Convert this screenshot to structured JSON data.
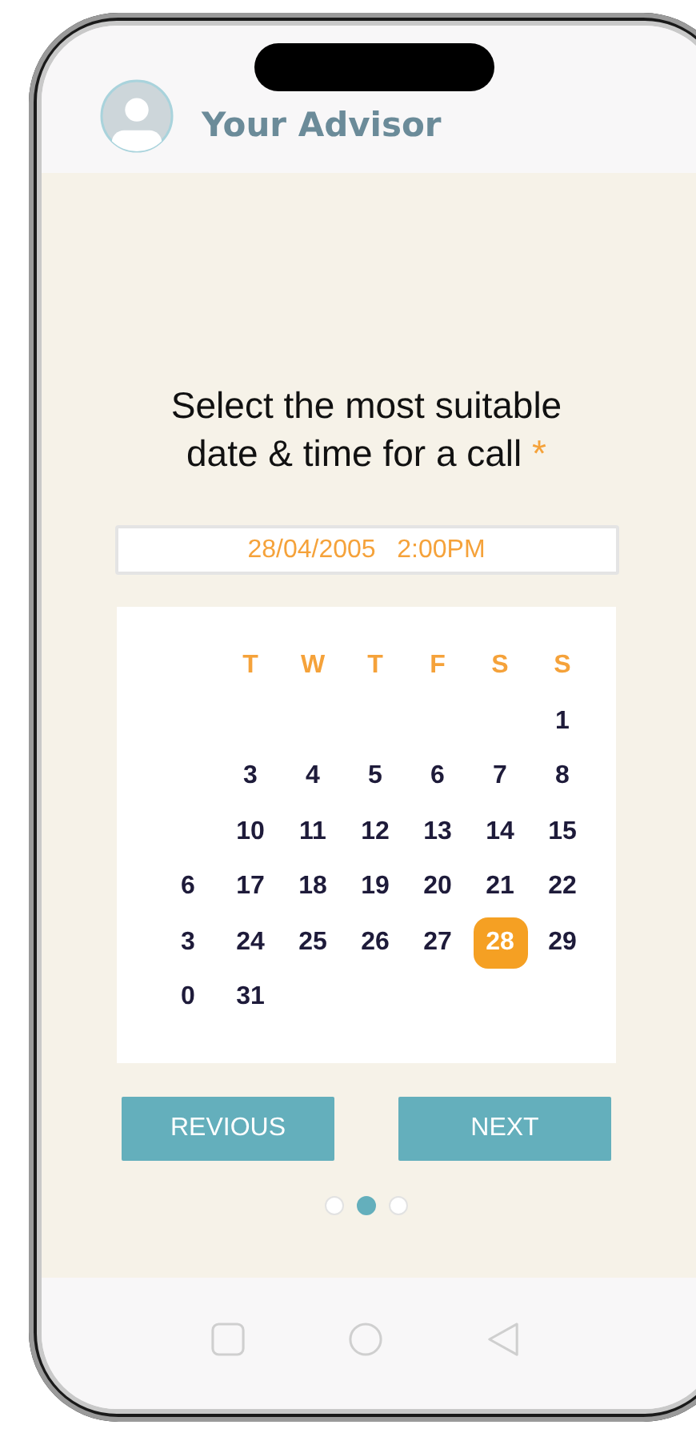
{
  "header": {
    "title": "Your Advisor"
  },
  "prompt": {
    "text": "Select the most suitable date & time for a call",
    "required_mark": "*"
  },
  "datetime_field": {
    "value": "28/04/2005   2:00PM"
  },
  "calendar": {
    "weekdays": [
      "T",
      "W",
      "T",
      "F",
      "S",
      "S"
    ],
    "weeks": [
      [
        {
          "day": "1",
          "selected": false
        }
      ],
      [
        {
          "day": "3",
          "selected": false
        },
        {
          "day": "4",
          "selected": false
        },
        {
          "day": "5",
          "selected": false
        },
        {
          "day": "6",
          "selected": false
        },
        {
          "day": "7",
          "selected": false
        },
        {
          "day": "8",
          "selected": false
        }
      ],
      [
        {
          "day": "10",
          "selected": false
        },
        {
          "day": "11",
          "selected": false
        },
        {
          "day": "12",
          "selected": false
        },
        {
          "day": "13",
          "selected": false
        },
        {
          "day": "14",
          "selected": false
        },
        {
          "day": "15",
          "selected": false
        }
      ],
      [
        {
          "day": "6",
          "selected": false
        },
        {
          "day": "17",
          "selected": false
        },
        {
          "day": "18",
          "selected": false
        },
        {
          "day": "19",
          "selected": false
        },
        {
          "day": "20",
          "selected": false
        },
        {
          "day": "21",
          "selected": false
        },
        {
          "day": "22",
          "selected": false
        }
      ],
      [
        {
          "day": "3",
          "selected": false
        },
        {
          "day": "24",
          "selected": false
        },
        {
          "day": "25",
          "selected": false
        },
        {
          "day": "26",
          "selected": false
        },
        {
          "day": "27",
          "selected": false
        },
        {
          "day": "28",
          "selected": true
        },
        {
          "day": "29",
          "selected": false
        }
      ],
      [
        {
          "day": "0",
          "selected": false
        },
        {
          "day": "31",
          "selected": false
        }
      ]
    ]
  },
  "buttons": [
    {
      "label": "REVIOUS"
    },
    {
      "label": "NEXT"
    }
  ],
  "pager": [
    {
      "selected": false
    },
    {
      "selected": true
    },
    {
      "selected": false
    }
  ]
}
